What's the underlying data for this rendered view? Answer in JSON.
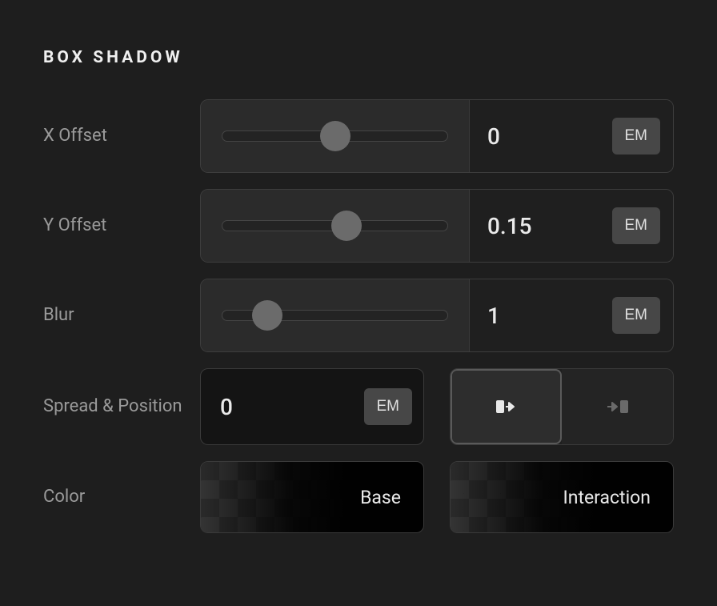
{
  "section": {
    "title": "BOX SHADOW"
  },
  "rows": {
    "xoffset": {
      "label": "X Offset",
      "value": "0",
      "unit": "EM",
      "thumb_pct": 50
    },
    "yoffset": {
      "label": "Y Offset",
      "value": "0.15",
      "unit": "EM",
      "thumb_pct": 55
    },
    "blur": {
      "label": "Blur",
      "value": "1",
      "unit": "EM",
      "thumb_pct": 20
    }
  },
  "spread": {
    "label": "Spread & Position",
    "value": "0",
    "unit": "EM"
  },
  "position": {
    "active": "outset"
  },
  "color": {
    "label": "Color",
    "base_label": "Base",
    "interaction_label": "Interaction"
  }
}
